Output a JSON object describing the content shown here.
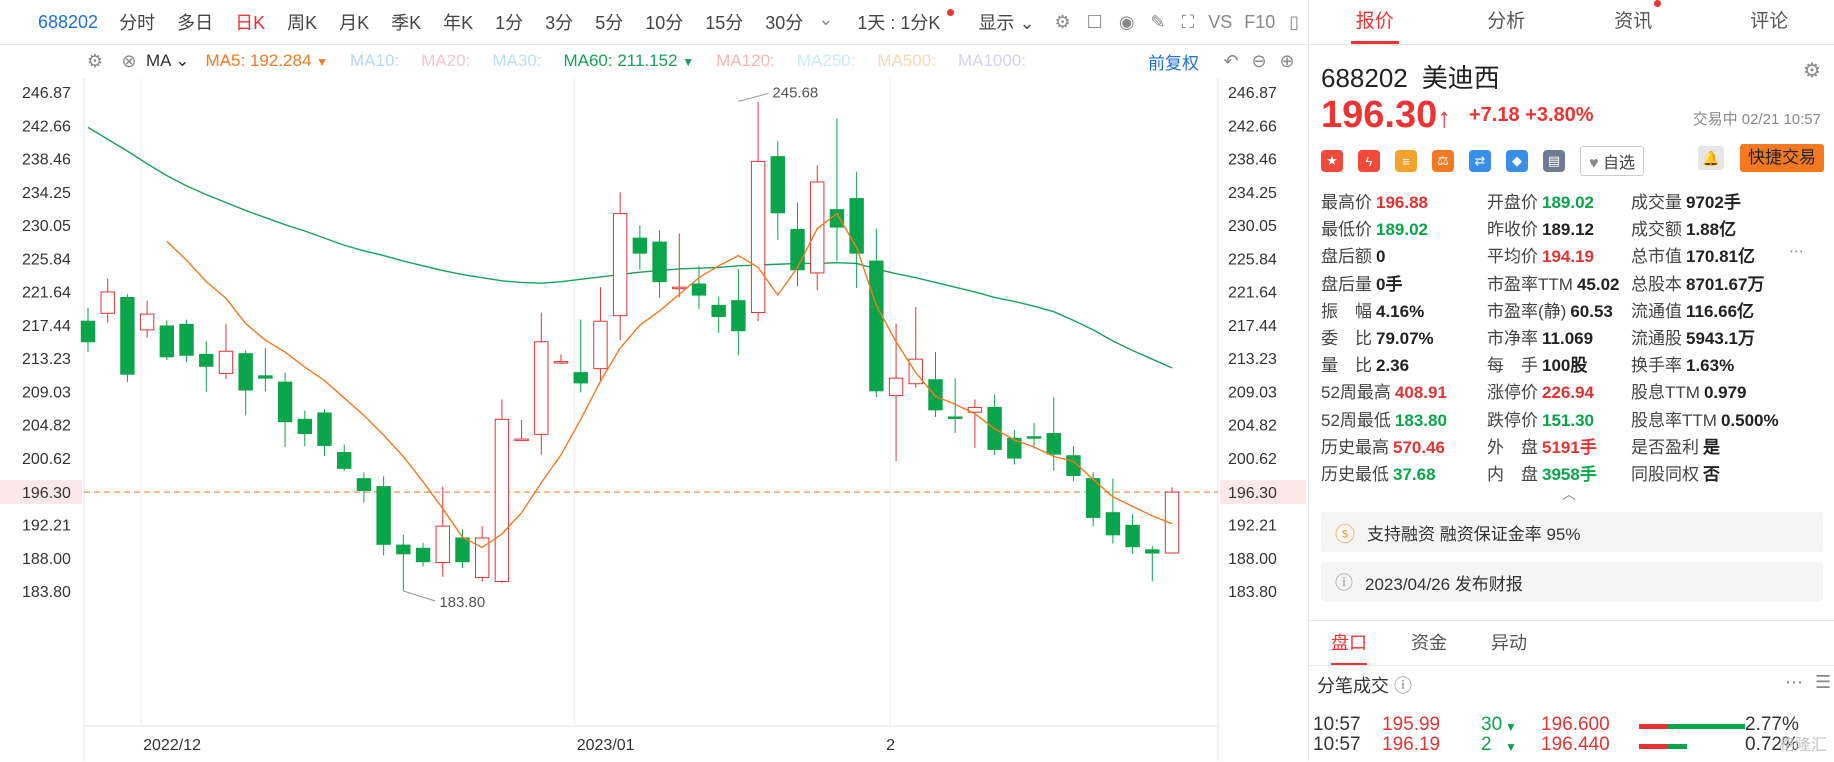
{
  "toolbar": {
    "code": "688202",
    "periods": [
      "分时",
      "多日",
      "日K",
      "周K",
      "月K",
      "季K",
      "年K",
      "1分",
      "3分",
      "5分",
      "10分",
      "15分",
      "30分"
    ],
    "active_period": "日K",
    "range_label": "1天 : 1分K",
    "display_label": "显示",
    "vs_label": "VS",
    "f10_label": "F10"
  },
  "ma_bar": {
    "type_label": "MA",
    "items": [
      {
        "label": "MA5:",
        "value": "192.284",
        "color": "#f47920"
      },
      {
        "label": "MA10:",
        "value": "",
        "color": "#b7d7f2"
      },
      {
        "label": "MA20:",
        "value": "",
        "color": "#f5c6d6"
      },
      {
        "label": "MA30:",
        "value": "",
        "color": "#bde0ef"
      },
      {
        "label": "MA60:",
        "value": "211.152",
        "color": "#1aa05c"
      },
      {
        "label": "MA120:",
        "value": "",
        "color": "#f5b5b5"
      },
      {
        "label": "MA250:",
        "value": "",
        "color": "#c9ecf7"
      },
      {
        "label": "MA500:",
        "value": "",
        "color": "#f7d7b5"
      },
      {
        "label": "MA1000:",
        "value": "",
        "color": "#d8d0f0"
      }
    ],
    "adjust_label": "前复权"
  },
  "colors": {
    "up": "#e33333",
    "down": "#0aa54a",
    "ma5": "#f47920",
    "ma60": "#1aa05c",
    "accent": "#1e6fd9"
  },
  "chart_data": {
    "type": "candlestick",
    "y_ticks": [
      "246.87",
      "242.66",
      "238.46",
      "234.25",
      "230.05",
      "225.84",
      "221.64",
      "217.44",
      "213.23",
      "209.03",
      "204.82",
      "200.62",
      "196.30",
      "192.21",
      "188.00",
      "183.80"
    ],
    "ylim": [
      183.8,
      246.87
    ],
    "x_labels": [
      {
        "label": "2022/12",
        "index": 3
      },
      {
        "label": "2023/01",
        "index": 25
      },
      {
        "label": "2",
        "index": 41
      }
    ],
    "current_price": "196.30",
    "annotations": [
      {
        "label": "245.68",
        "index": 33,
        "value": 245.68
      },
      {
        "label": "183.80",
        "index": 16,
        "value": 183.8
      }
    ],
    "candles": [
      [
        217.9,
        215.3,
        219.6,
        214.0
      ],
      [
        218.9,
        221.6,
        223.3,
        217.7
      ],
      [
        220.9,
        211.2,
        221.3,
        210.2
      ],
      [
        216.8,
        218.8,
        220.5,
        215.8
      ],
      [
        217.3,
        213.4,
        218.0,
        213.0
      ],
      [
        217.5,
        213.6,
        218.1,
        212.7
      ],
      [
        213.7,
        212.2,
        215.4,
        209.0
      ],
      [
        211.3,
        214.1,
        217.6,
        210.6
      ],
      [
        213.8,
        209.2,
        214.2,
        206.0
      ],
      [
        211.0,
        210.7,
        214.5,
        209.0
      ],
      [
        210.2,
        205.2,
        211.4,
        202.0
      ],
      [
        205.5,
        203.7,
        206.6,
        202.1
      ],
      [
        206.3,
        202.2,
        206.8,
        200.9
      ],
      [
        201.3,
        199.3,
        202.3,
        199.0
      ],
      [
        198.0,
        196.5,
        198.8,
        195.0
      ],
      [
        197.0,
        189.7,
        198.3,
        188.3
      ],
      [
        189.6,
        188.5,
        190.9,
        183.8
      ],
      [
        189.2,
        187.5,
        189.9,
        186.9
      ],
      [
        187.4,
        192.0,
        197.0,
        185.6
      ],
      [
        190.5,
        187.5,
        191.6,
        186.7
      ],
      [
        185.5,
        190.5,
        192.0,
        185.0
      ],
      [
        185.0,
        205.5,
        208.0,
        184.8
      ],
      [
        203.0,
        203.0,
        205.4,
        203.0
      ],
      [
        203.6,
        215.3,
        219.0,
        201.0
      ],
      [
        212.8,
        212.8,
        213.7,
        212.5
      ],
      [
        211.4,
        210.1,
        218.1,
        208.9
      ],
      [
        211.9,
        217.9,
        222.2,
        210.2
      ],
      [
        218.6,
        231.5,
        234.2,
        215.5
      ],
      [
        228.4,
        226.5,
        230.0,
        224.4
      ],
      [
        227.9,
        222.9,
        229.4,
        220.9
      ],
      [
        222.2,
        222.2,
        229.0,
        220.9
      ],
      [
        222.6,
        221.2,
        224.9,
        219.4
      ],
      [
        219.9,
        218.5,
        221.0,
        216.4
      ],
      [
        220.5,
        216.7,
        224.5,
        213.6
      ],
      [
        219.0,
        238.1,
        245.6,
        217.9
      ],
      [
        238.7,
        231.6,
        240.7,
        228.2
      ],
      [
        229.5,
        224.4,
        232.9,
        222.3
      ],
      [
        224.0,
        235.5,
        237.6,
        221.8
      ],
      [
        232.0,
        229.8,
        243.5,
        225.5
      ],
      [
        233.4,
        226.5,
        236.8,
        222.1
      ],
      [
        225.5,
        209.1,
        229.6,
        208.3
      ],
      [
        208.5,
        210.7,
        217.6,
        200.2
      ],
      [
        210.0,
        213.1,
        219.7,
        209.5
      ],
      [
        210.5,
        206.7,
        214.0,
        205.8
      ],
      [
        205.8,
        205.6,
        210.7,
        203.8
      ],
      [
        206.4,
        207.0,
        208.0,
        201.9
      ],
      [
        207.0,
        201.7,
        208.6,
        201.0
      ],
      [
        203.1,
        200.6,
        204.2,
        199.8
      ],
      [
        203.3,
        203.2,
        205.0,
        201.8
      ],
      [
        203.7,
        201.1,
        208.3,
        199.0
      ],
      [
        200.9,
        198.4,
        202.1,
        197.7
      ],
      [
        198.0,
        193.1,
        198.8,
        192.0
      ],
      [
        193.7,
        190.9,
        198.0,
        189.8
      ],
      [
        192.1,
        189.4,
        193.5,
        188.5
      ],
      [
        189.0,
        188.6,
        189.5,
        185.0
      ],
      [
        188.6,
        196.3,
        196.9,
        189.0
      ]
    ],
    "ma5": [
      null,
      null,
      null,
      null,
      228.0,
      225.6,
      222.9,
      220.8,
      217.6,
      215.5,
      214.0,
      212.1,
      210.4,
      208.2,
      206.0,
      203.5,
      200.8,
      197.6,
      194.2,
      190.6,
      189.3,
      191.0,
      193.7,
      197.5,
      201.0,
      205.5,
      210.3,
      214.5,
      217.4,
      219.2,
      221.3,
      223.4,
      224.9,
      226.2,
      224.7,
      221.2,
      224.7,
      229.6,
      231.5,
      227.2,
      219.9,
      215.3,
      211.4,
      208.4,
      207.4,
      206.2,
      204.3,
      202.9,
      202.0,
      200.8,
      200.2,
      197.9,
      195.7,
      194.5,
      193.3,
      192.3
    ],
    "ma60": [
      242.4,
      240.9,
      239.4,
      237.8,
      236.3,
      235.0,
      233.9,
      232.9,
      231.9,
      231.0,
      230.1,
      229.3,
      228.4,
      227.5,
      226.8,
      226.2,
      225.5,
      224.9,
      224.3,
      223.8,
      223.4,
      223.0,
      222.8,
      222.7,
      222.9,
      223.2,
      223.5,
      223.8,
      224.1,
      224.3,
      224.5,
      224.6,
      224.7,
      224.9,
      225.0,
      225.1,
      225.2,
      225.2,
      225.3,
      225.2,
      224.5,
      223.9,
      223.4,
      222.8,
      222.2,
      221.6,
      220.9,
      220.4,
      219.8,
      219.1,
      218.0,
      216.8,
      215.4,
      214.2,
      213.1,
      212.0
    ]
  },
  "quote": {
    "code": "688202",
    "name": "美迪西",
    "price": "196.30",
    "change": "+7.18",
    "change_pct": "+3.80%",
    "status": "交易中 02/21 10:57",
    "watch_label": "自选",
    "quick_trade_label": "快捷交易",
    "rows": [
      [
        {
          "l": "最高价",
          "v": "196.88",
          "c": "up"
        },
        {
          "l": "开盘价",
          "v": "189.02",
          "c": "down"
        },
        {
          "l": "成交量",
          "v": "9702手",
          "c": "n"
        }
      ],
      [
        {
          "l": "最低价",
          "v": "189.02",
          "c": "down"
        },
        {
          "l": "昨收价",
          "v": "189.12",
          "c": "n"
        },
        {
          "l": "成交额",
          "v": "1.88亿",
          "c": "n"
        }
      ],
      [
        {
          "l": "盘后额",
          "v": "0",
          "c": "n"
        },
        {
          "l": "平均价",
          "v": "194.19",
          "c": "up"
        },
        {
          "l": "总市值",
          "v": "170.81亿",
          "c": "n"
        }
      ],
      [
        {
          "l": "盘后量",
          "v": "0手",
          "c": "n"
        },
        {
          "l": "市盈率TTM",
          "v": "45.02",
          "c": "n"
        },
        {
          "l": "总股本",
          "v": "8701.67万",
          "c": "n"
        }
      ],
      [
        {
          "l": "振　幅",
          "v": "4.16%",
          "c": "n"
        },
        {
          "l": "市盈率(静)",
          "v": "60.53",
          "c": "n"
        },
        {
          "l": "流通值",
          "v": "116.66亿",
          "c": "n"
        }
      ],
      [
        {
          "l": "委　比",
          "v": "79.07%",
          "c": "n"
        },
        {
          "l": "市净率",
          "v": "11.069",
          "c": "n"
        },
        {
          "l": "流通股",
          "v": "5943.1万",
          "c": "n"
        }
      ],
      [
        {
          "l": "量　比",
          "v": "2.36",
          "c": "n"
        },
        {
          "l": "每　手",
          "v": "100股",
          "c": "n"
        },
        {
          "l": "换手率",
          "v": "1.63%",
          "c": "n"
        }
      ],
      [
        {
          "l": "52周最高",
          "v": "408.91",
          "c": "up"
        },
        {
          "l": "涨停价",
          "v": "226.94",
          "c": "up"
        },
        {
          "l": "股息TTM",
          "v": "0.979",
          "c": "n"
        }
      ],
      [
        {
          "l": "52周最低",
          "v": "183.80",
          "c": "down"
        },
        {
          "l": "跌停价",
          "v": "151.30",
          "c": "down"
        },
        {
          "l": "股息率TTM",
          "v": "0.500%",
          "c": "n"
        }
      ],
      [
        {
          "l": "历史最高",
          "v": "570.46",
          "c": "up"
        },
        {
          "l": "外　盘",
          "v": "5191手",
          "c": "up"
        },
        {
          "l": "是否盈利",
          "v": "是",
          "c": "n"
        }
      ],
      [
        {
          "l": "历史最低",
          "v": "37.68",
          "c": "down"
        },
        {
          "l": "内　盘",
          "v": "3958手",
          "c": "down"
        },
        {
          "l": "同股同权",
          "v": "否",
          "c": "n"
        }
      ]
    ],
    "margin_info": "支持融资  融资保证金率 95%",
    "report_info": "2023/04/26  发布财报"
  },
  "right_tabs": [
    "报价",
    "分析",
    "资讯",
    "评论"
  ],
  "sub_tabs": [
    "盘口",
    "资金",
    "异动"
  ],
  "trades_title": "分笔成交",
  "trades": [
    {
      "time": "10:57",
      "price": "195.99",
      "vol": "30",
      "level": "196.600",
      "pct": "2.77%"
    },
    {
      "time": "10:57",
      "price": "196.19",
      "vol": "2",
      "level": "196.440",
      "pct": "0.72%"
    }
  ],
  "watermark": "格隆汇"
}
